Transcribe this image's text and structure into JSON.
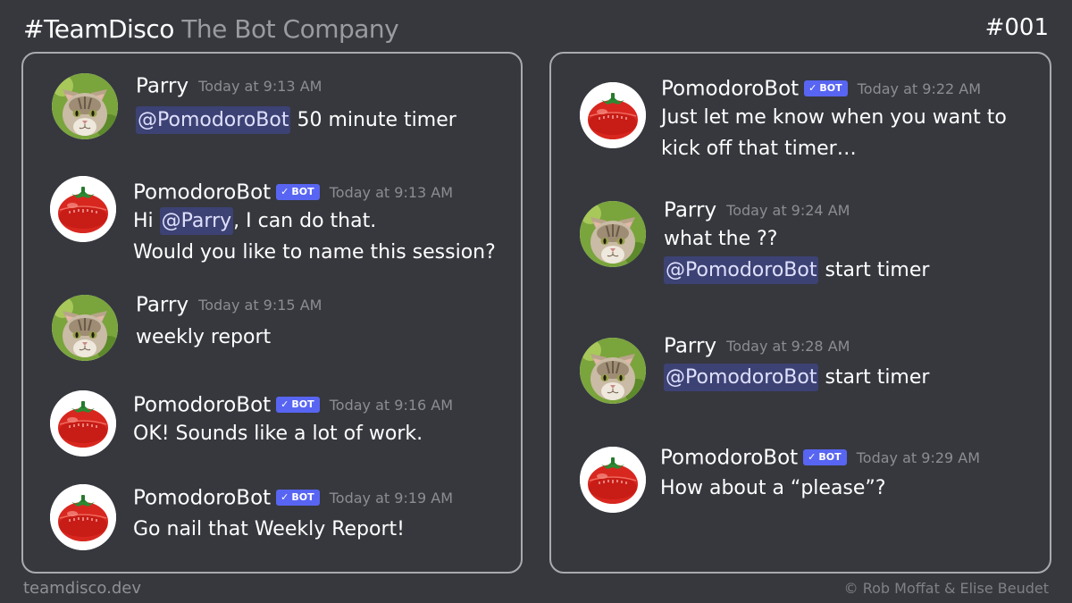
{
  "header": {
    "brand": "#TeamDisco",
    "company": "The Bot Company",
    "issue": "#001"
  },
  "footer": {
    "site": "teamdisco.dev",
    "credit": "© Rob Moffat & Elise Beudet"
  },
  "badge_label": "BOT",
  "colors": {
    "background": "#36383e",
    "mention_bg": "#3d4274",
    "badge_bg": "#5865f2",
    "timestamp": "#8b8d92"
  },
  "left_panel": {
    "messages": [
      {
        "author": "Parry",
        "avatar": "cat-avatar",
        "time": "Today at 9:13 AM",
        "mention": "@PomodoroBot",
        "text": " 50 minute timer"
      },
      {
        "author": "PomodoroBot",
        "avatar": "tomato-timer-avatar",
        "bot": true,
        "time": "Today at 9:13 AM",
        "line1_prefix": "Hi ",
        "line1_mention": "@Parry",
        "line1_suffix": ", I can do that.",
        "line2": "Would you like to name this session?"
      },
      {
        "author": "Parry",
        "avatar": "cat-avatar",
        "time": "Today at 9:15 AM",
        "text": "weekly report"
      },
      {
        "author": "PomodoroBot",
        "avatar": "tomato-timer-avatar",
        "bot": true,
        "time": "Today at 9:16 AM",
        "text": "OK! Sounds like a lot of work."
      },
      {
        "author": "PomodoroBot",
        "avatar": "tomato-timer-avatar",
        "bot": true,
        "time": "Today at 9:19 AM",
        "text": "Go nail that Weekly Report!"
      }
    ]
  },
  "right_panel": {
    "messages": [
      {
        "author": "PomodoroBot",
        "avatar": "tomato-timer-avatar",
        "bot": true,
        "time": "Today at 9:22 AM",
        "line1": "Just let me know when you want to",
        "line2": "kick off that timer…"
      },
      {
        "author": "Parry",
        "avatar": "cat-avatar",
        "time": "Today at 9:24 AM",
        "line1": "what the ??",
        "mention": "@PomodoroBot",
        "line2_suffix": " start timer"
      },
      {
        "author": "Parry",
        "avatar": "cat-avatar",
        "time": "Today at 9:28 AM",
        "mention": "@PomodoroBot",
        "text": " start timer"
      },
      {
        "author": "PomodoroBot",
        "avatar": "tomato-timer-avatar",
        "bot": true,
        "time": "Today at 9:29 AM",
        "text": "How about a “please”?"
      }
    ]
  }
}
